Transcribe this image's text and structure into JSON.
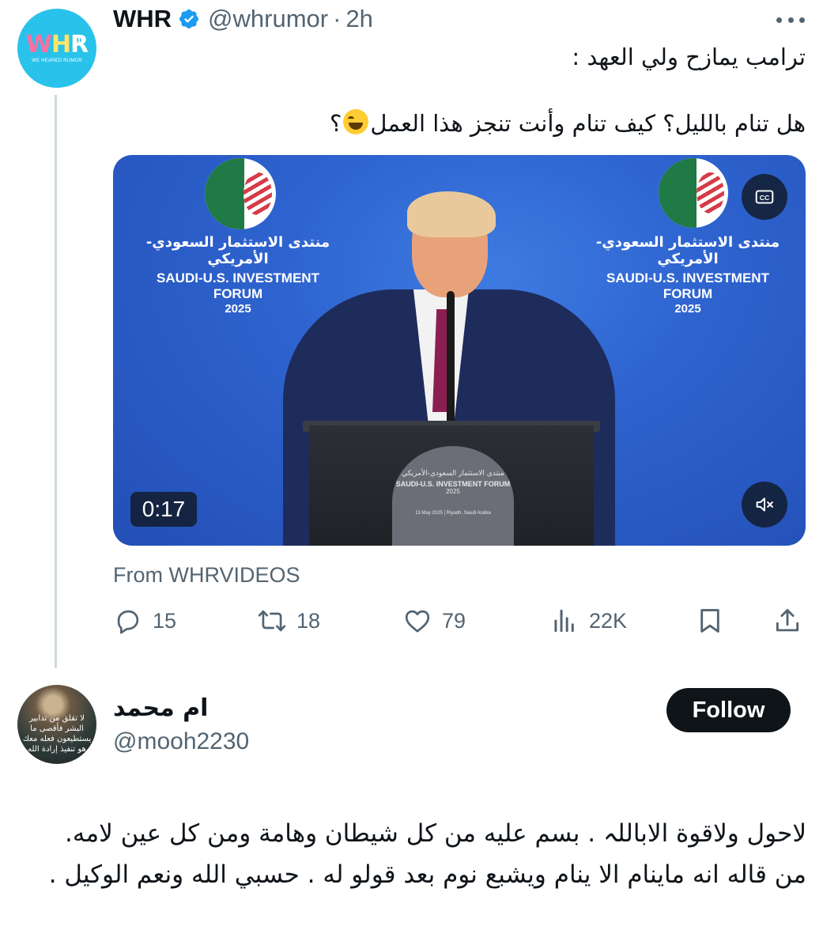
{
  "tweet": {
    "avatar": {
      "logo_w": "W",
      "logo_h": "H",
      "logo_r": "R",
      "tagline": "WE HEARED RUMOR",
      "bg_color": "#29c2ea"
    },
    "display_name": "WHR",
    "verified_icon": "verified-badge-icon",
    "handle": "@whrumor",
    "separator": "·",
    "time": "2h",
    "text_line1": "ترامب يمازح ولي العهد :",
    "text_line2": "هل تنام بالليل؟ كيف تنام وأنت تنجز هذا العمل",
    "text_line2_end": "؟",
    "emoji": "face-with-tears-of-joy",
    "video": {
      "duration": "0:17",
      "cc_label": "CC",
      "forum_name_ar": "منتدى الاستثمار السعودي-الأمريكي",
      "forum_name_en": "SAUDI-U.S. INVESTMENT FORUM",
      "forum_year": "2025",
      "podium_date": "13 May 2025 | Riyadh, Saudi Arabia"
    },
    "source": "From WHRVIDEOS",
    "stats": {
      "replies": "15",
      "retweets": "18",
      "likes": "79",
      "views": "22K"
    }
  },
  "reply": {
    "display_name": "ام محمد",
    "handle": "@mooh2230",
    "follow_label": "Follow",
    "avatar_text": "لا تقلق من تدابير البشر فأقصى ما يستطيعون فعله معك هو تنفيذ إرادة الله",
    "text": "لاحول ولاقوة الاباللہ . بسم عليه من كل شيطان وهامة ومن كل عين لامه. من قاله انه ماينام الا ينام ويشبع نوم بعد قولو له . حسبي الله ونعم الوكيل ."
  },
  "colors": {
    "accent": "#1d9bf0",
    "muted": "#536471",
    "text": "#0f1419",
    "button": "#0f1419"
  }
}
